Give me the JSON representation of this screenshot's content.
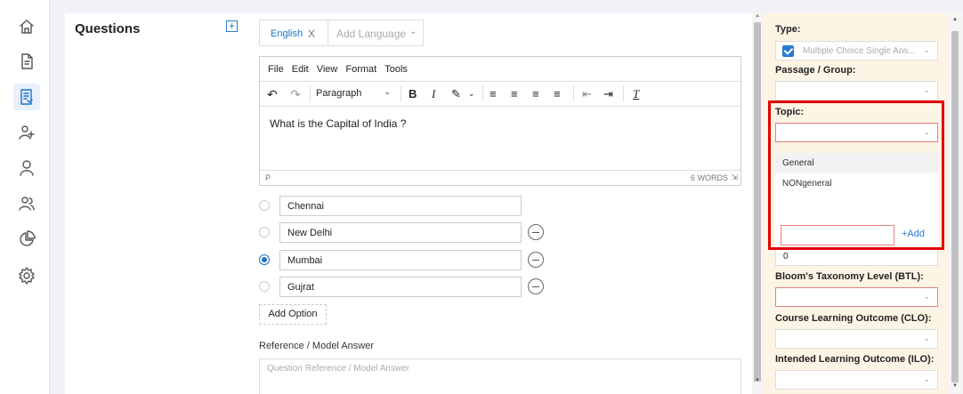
{
  "rail": {
    "items": [
      {
        "name": "home-icon",
        "active": false
      },
      {
        "name": "document-icon",
        "active": false
      },
      {
        "name": "question-bank-icon",
        "active": true
      },
      {
        "name": "add-user-icon",
        "active": false
      },
      {
        "name": "user-icon",
        "active": false
      },
      {
        "name": "users-icon",
        "active": false
      },
      {
        "name": "pie-chart-icon",
        "active": false
      },
      {
        "name": "gear-icon",
        "active": false
      }
    ]
  },
  "questions": {
    "title": "Questions",
    "add_icon": "+"
  },
  "language": {
    "active_tab": "English",
    "close_label": "X",
    "add_placeholder": "Add Language"
  },
  "editor": {
    "menu": [
      "File",
      "Edit",
      "View",
      "Format",
      "Tools"
    ],
    "block_format": "Paragraph",
    "content": "What is the Capital of India ?",
    "path": "P",
    "word_count": "6 WORDS"
  },
  "options": [
    {
      "value": "Chennai",
      "checked": false,
      "removable": false
    },
    {
      "value": "New Delhi",
      "checked": false,
      "removable": true
    },
    {
      "value": "Mumbai",
      "checked": true,
      "removable": true
    },
    {
      "value": "Gujrat",
      "checked": false,
      "removable": true
    }
  ],
  "add_option_label": "Add Option",
  "reference": {
    "label": "Reference / Model Answer",
    "placeholder": "Question Reference / Model Answer"
  },
  "props": {
    "type_label": "Type:",
    "type_value": "Multiple Choice Single Ans...",
    "passage_label": "Passage / Group:",
    "topic_label": "Topic:",
    "topic_options": [
      "General",
      "NONgeneral"
    ],
    "topic_add_label": "+Add",
    "marks_value": "0",
    "btl_label": "Bloom's Taxonomy Level (BTL):",
    "clo_label": "Course Learning Outcome (CLO):",
    "ilo_label": "Intended Learning Outcome (ILO):"
  },
  "colors": {
    "accent": "#1a73c8",
    "highlight": "#e00000",
    "props_bg": "#fdf4e5"
  }
}
